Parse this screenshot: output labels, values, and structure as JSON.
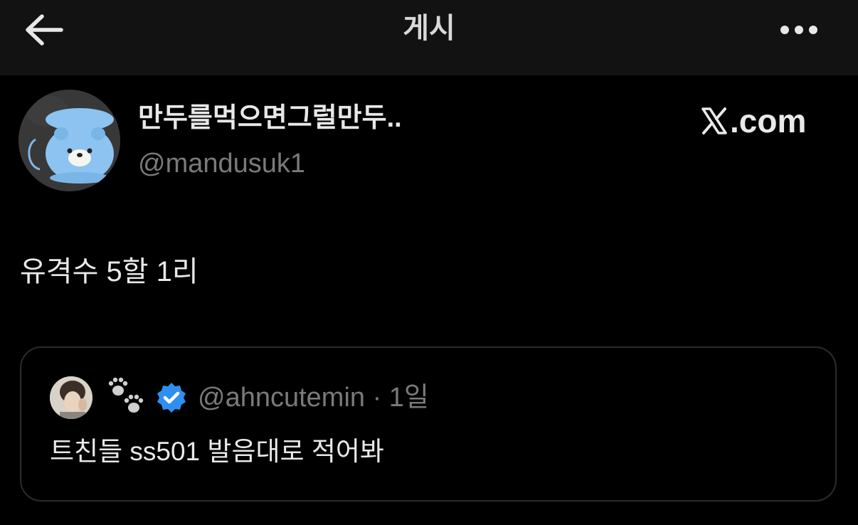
{
  "header": {
    "title": "게시",
    "back_icon": "arrow-left-icon",
    "more_icon": "more-horizontal-icon"
  },
  "post": {
    "display_name": "만두를먹으면그럴만두..",
    "handle": "@mandusuk1",
    "source_label": ".com",
    "source_icon": "x-logo-icon",
    "text": "유격수 5할 1리",
    "avatar_icon": "blue-bear-plush-avatar"
  },
  "quote": {
    "handle": "@ahncutemin · 1일",
    "text": "트친들 ss501 발음대로 적어봐",
    "emoji_icon": "paw-prints-icon",
    "verified_icon": "verified-badge-icon",
    "avatar_icon": "user-photo-avatar"
  },
  "colors": {
    "background": "#000000",
    "topbar": "#121212",
    "primary_text": "#e8e8e8",
    "secondary_text": "#7a7a7a",
    "verified_blue": "#2f8ff0",
    "card_border": "#2c2c2c"
  }
}
